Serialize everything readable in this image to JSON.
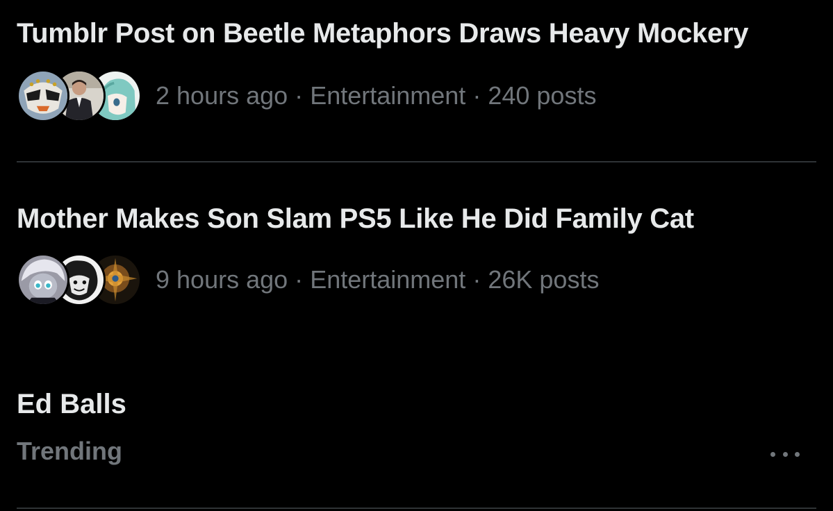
{
  "stories": [
    {
      "title": "Tumblr Post on Beetle Metaphors Draws Heavy Mockery",
      "time": "2 hours ago",
      "category": "Entertainment",
      "posts": "240 posts"
    },
    {
      "title": "Mother Makes Son Slam PS5 Like He Did Family Cat",
      "time": "9 hours ago",
      "category": "Entertainment",
      "posts": "26K posts"
    }
  ],
  "separator": "·",
  "trend": {
    "title": "Ed Balls",
    "subtitle": "Trending"
  },
  "more_icon": "more-horizontal-icon",
  "colors": {
    "background": "#000000",
    "primary_text": "#e7e9ea",
    "secondary_text": "#71767b",
    "divider": "#2f3336"
  }
}
